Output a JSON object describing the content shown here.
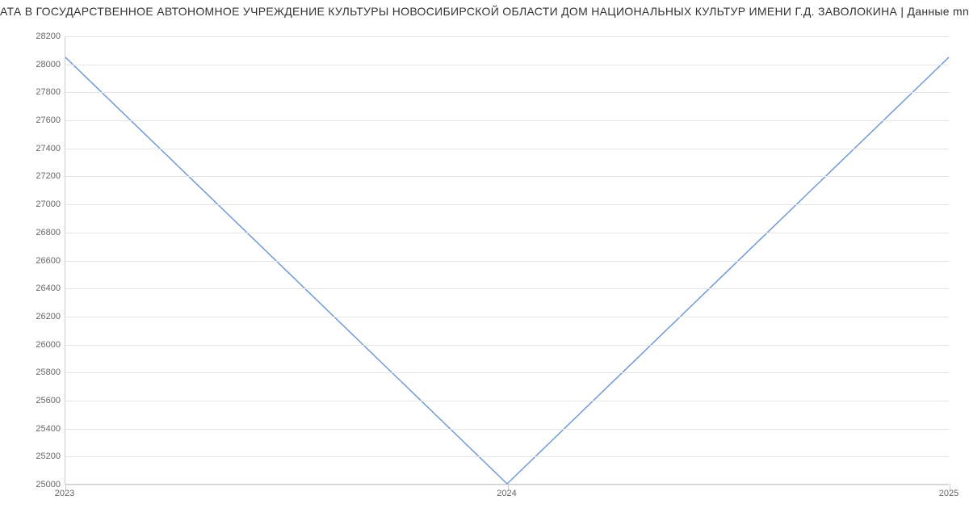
{
  "chart_data": {
    "type": "line",
    "title": "АТА В ГОСУДАРСТВЕННОЕ АВТОНОМНОЕ УЧРЕЖДЕНИЕ КУЛЬТУРЫ НОВОСИБИРСКОЙ ОБЛАСТИ ДОМ НАЦИОНАЛЬНЫХ КУЛЬТУР ИМЕНИ Г.Д. ЗАВОЛОКИНА | Данные mnogo",
    "x": [
      2023,
      2024,
      2025
    ],
    "values": [
      28050,
      25000,
      28050
    ],
    "xlabel": "",
    "ylabel": "",
    "xlim": [
      2023,
      2025
    ],
    "ylim": [
      25000,
      28200
    ],
    "y_ticks": [
      25000,
      25200,
      25400,
      25600,
      25800,
      26000,
      26200,
      26400,
      26600,
      26800,
      27000,
      27200,
      27400,
      27600,
      27800,
      28000,
      28200
    ],
    "x_ticks": [
      2023,
      2024,
      2025
    ],
    "line_color": "#6f9bd8"
  }
}
